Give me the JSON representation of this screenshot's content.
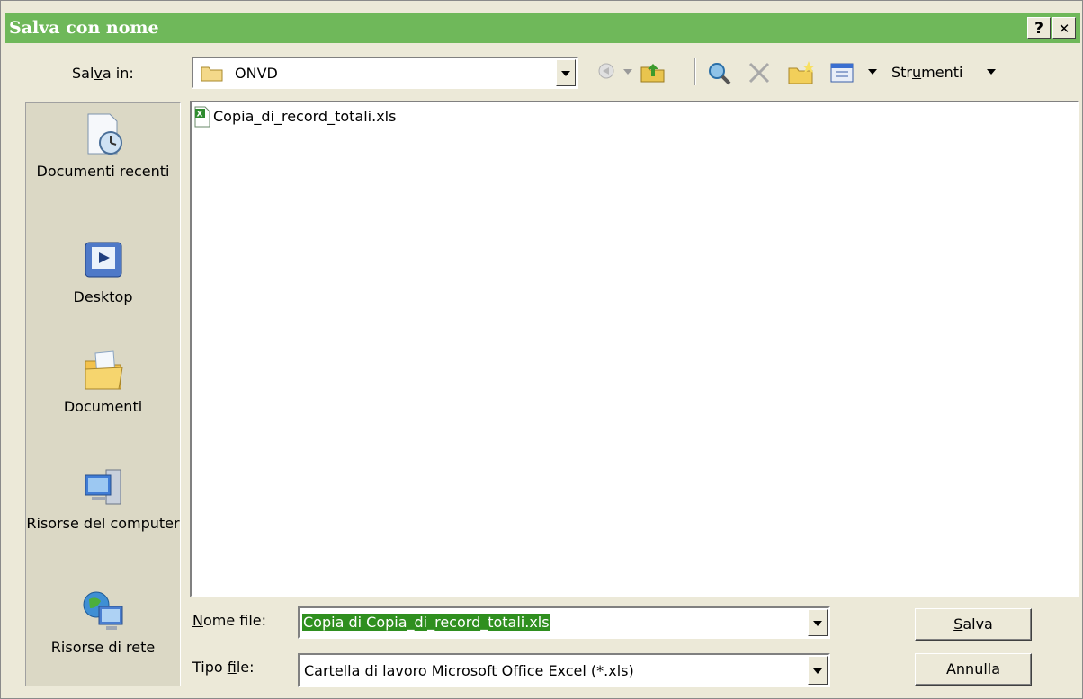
{
  "window": {
    "title": "Salva con nome",
    "help_button": "?",
    "close_button": "✕"
  },
  "location": {
    "label_pre": "Sal",
    "label_accel": "v",
    "label_post": "a in:",
    "value": "ONVD"
  },
  "toolbar": {
    "tools_pre": "Str",
    "tools_accel": "u",
    "tools_post": "menti"
  },
  "places": [
    {
      "label": "Documenti recenti",
      "icon": "recent-documents-icon"
    },
    {
      "label": "Desktop",
      "icon": "desktop-icon"
    },
    {
      "label": "Documenti",
      "icon": "my-documents-icon"
    },
    {
      "label": "Risorse del computer",
      "icon": "my-computer-icon"
    },
    {
      "label": "Risorse di rete",
      "icon": "network-places-icon"
    }
  ],
  "files": [
    {
      "name": "Copia_di_record_totali.xls",
      "icon": "excel-file-icon"
    }
  ],
  "filename": {
    "label_pre": "",
    "label_accel": "N",
    "label_post": "ome file:",
    "value": "Copia di Copia_di_record_totali.xls"
  },
  "filetype": {
    "label_pre": "Tipo ",
    "label_accel": "f",
    "label_post": "ile:",
    "value": "Cartella di lavoro Microsoft Office Excel (*.xls)"
  },
  "buttons": {
    "save_accel": "S",
    "save_rest": "alva",
    "cancel": "Annulla"
  },
  "colors": {
    "titlebar": "#6fb85a",
    "selection": "#2f8f1f"
  }
}
